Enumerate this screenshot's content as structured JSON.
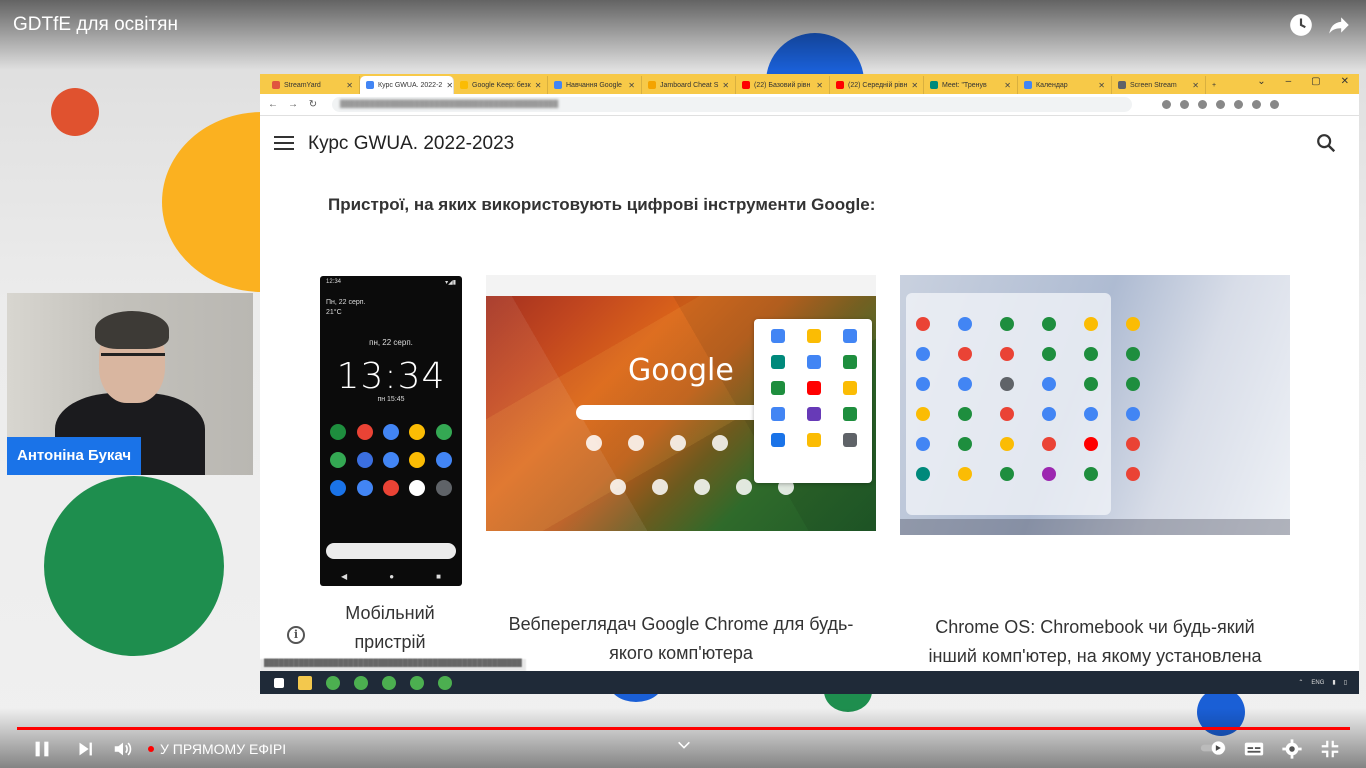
{
  "video": {
    "title": "GDTfE для освітян",
    "live_label": "У ПРЯМОМУ ЕФІРІ"
  },
  "presenter": {
    "name": "Антоніна Букач"
  },
  "browser": {
    "tabs": [
      {
        "label": "StreamYard",
        "color": "#e0553f"
      },
      {
        "label": "Курс GWUA. 2022-2",
        "color": "#4285f4",
        "active": true
      },
      {
        "label": "Google Keep: безк",
        "color": "#fbbc04"
      },
      {
        "label": "Навчання Google",
        "color": "#4285f4"
      },
      {
        "label": "Jamboard Cheat S",
        "color": "#f4a300"
      },
      {
        "label": "(22) Базовий рівн",
        "color": "#ff0000"
      },
      {
        "label": "(22) Середній рівн",
        "color": "#ff0000"
      },
      {
        "label": "Meet: \"Тренув",
        "color": "#00897b"
      },
      {
        "label": "Календар",
        "color": "#4285f4"
      },
      {
        "label": "Screen Stream",
        "color": "#5f6368"
      }
    ]
  },
  "site": {
    "title": "Курс GWUA. 2022-2023",
    "heading": "Пристрої, на яких використовують цифрові інструменти Google:",
    "captions": {
      "mobile": [
        "Мобільний",
        "пристрій"
      ],
      "chrome": [
        "Вебпереглядач Google Chrome для будь-",
        "якого комп'ютера"
      ],
      "chromeos": [
        "Chrome OS: Chromebook чи будь-який",
        "інший комп'ютер, на якому установлена"
      ]
    },
    "phone": {
      "date_small": "Пн, 22 серп.",
      "temp": "21°C",
      "date": "пн, 22 серп.",
      "clock": "13:34",
      "alarm": "пн 15:45"
    },
    "google_logo": "Google"
  },
  "colors": {
    "yellow": "#fbbc04",
    "red": "#ea4335",
    "green": "#1e8e3e",
    "blue": "#1a73e8",
    "progress": "#ff0000"
  },
  "icons": [
    "history-icon",
    "share-icon",
    "pause-icon",
    "next-icon",
    "volume-icon",
    "chevron-down-icon",
    "subtitles-icon",
    "settings-icon",
    "exit-fullscreen-icon",
    "menu-icon",
    "search-icon",
    "info-icon"
  ]
}
